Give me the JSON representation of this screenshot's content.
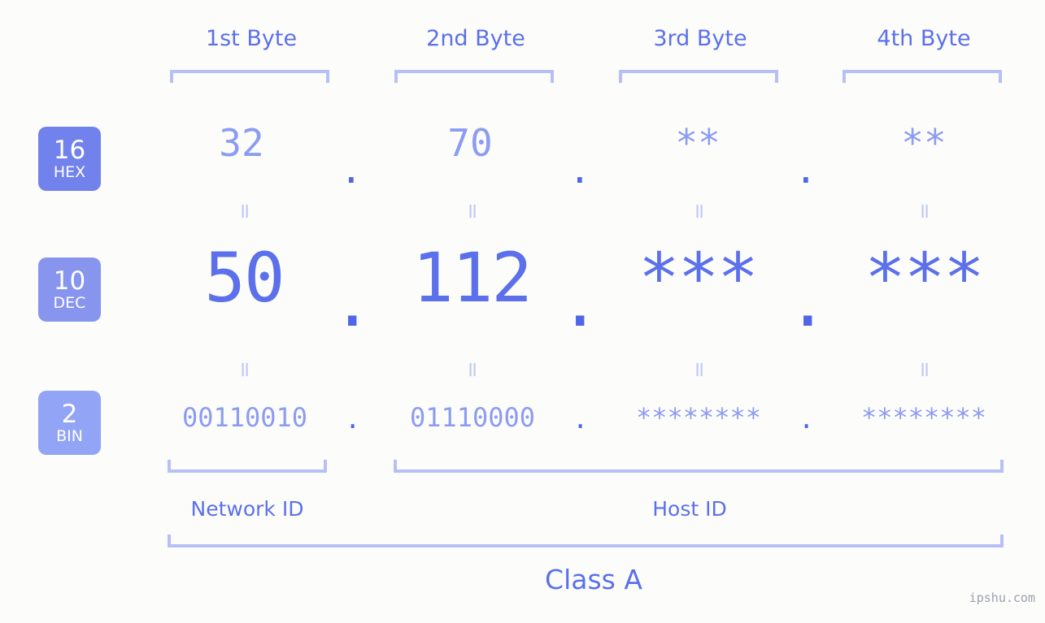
{
  "meta": {
    "watermark": "ipshu.com",
    "background_color": "#fcfdfa",
    "accent_strong": "#4f66e8",
    "accent_mid": "#5b70ea",
    "accent_light": "#8c9cf2",
    "accent_rule": "#b6c0f7"
  },
  "headers": [
    {
      "label": "1st Byte"
    },
    {
      "label": "2nd Byte"
    },
    {
      "label": "3rd Byte"
    },
    {
      "label": "4th Byte"
    }
  ],
  "bases": [
    {
      "num": "16",
      "label": "HEX",
      "color": "#7182ec"
    },
    {
      "num": "10",
      "label": "DEC",
      "color": "#8895ef"
    },
    {
      "num": "2",
      "label": "BIN",
      "color": "#92a4f5"
    }
  ],
  "rows": {
    "hex": {
      "base_num": "16",
      "base_label": "HEX",
      "values": [
        "32",
        "70",
        "**",
        "**"
      ],
      "separator": "."
    },
    "dec": {
      "base_num": "10",
      "base_label": "DEC",
      "values": [
        "50",
        "112",
        "***",
        "***"
      ],
      "separator": "."
    },
    "bin": {
      "base_num": "2",
      "base_label": "BIN",
      "values": [
        "00110010",
        "01110000",
        "********",
        "********"
      ],
      "separator": "."
    }
  },
  "equals_symbol": "=",
  "segments": {
    "network_id": "Network ID",
    "host_id": "Host ID",
    "class": "Class A"
  }
}
